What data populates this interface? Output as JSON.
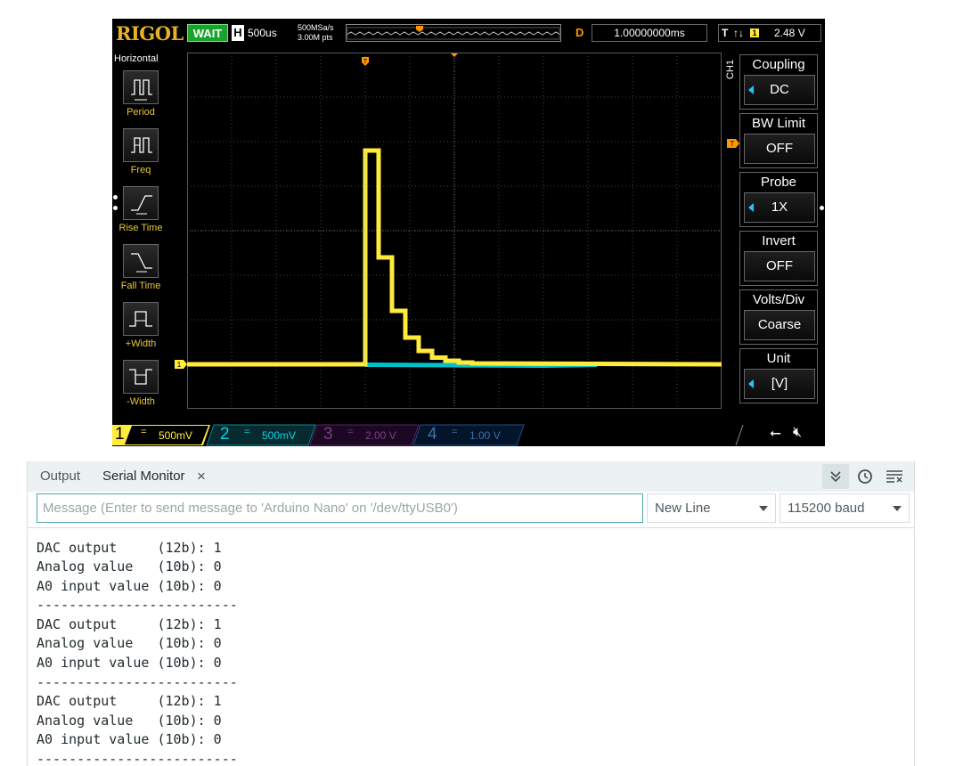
{
  "scope": {
    "brand": "RIGOL",
    "run_status": "WAIT",
    "horizontal_tag": "H",
    "timebase": "500us",
    "sample_rate": "500MSa/s",
    "memory_depth": "3.00M pts",
    "delay_tag": "D",
    "delay": "1.00000000ms",
    "trigger_tag": "T",
    "trigger_source": "1",
    "trigger_level": "2.48 V",
    "trigger_marker": "T",
    "colors": {
      "ch1": "#ffeb3b",
      "ch2": "#00d6e0",
      "ch3": "#c71ddb",
      "ch4": "#2196f3",
      "accent": "#ff9800"
    },
    "left_menu": {
      "title": "Horizontal",
      "items": [
        {
          "label": "Period",
          "icon": "period-icon"
        },
        {
          "label": "Freq",
          "icon": "freq-icon"
        },
        {
          "label": "Rise Time",
          "icon": "rise-time-icon"
        },
        {
          "label": "Fall Time",
          "icon": "fall-time-icon"
        },
        {
          "label": "+Width",
          "icon": "pos-width-icon"
        },
        {
          "label": "-Width",
          "icon": "neg-width-icon"
        }
      ]
    },
    "right_menu": {
      "channel_label": "CH1",
      "items": [
        {
          "title": "Coupling",
          "value": "DC"
        },
        {
          "title": "BW Limit",
          "value": "OFF"
        },
        {
          "title": "Probe",
          "value": "1X"
        },
        {
          "title": "Invert",
          "value": "OFF"
        },
        {
          "title": "Volts/Div",
          "value": "Coarse"
        },
        {
          "title": "Unit",
          "value": "[V]"
        }
      ]
    },
    "channels": [
      {
        "num": "1",
        "coupling": "=",
        "scale": "500mV"
      },
      {
        "num": "2",
        "coupling": "=",
        "scale": "500mV"
      },
      {
        "num": "3",
        "coupling": "=",
        "scale": "2.00 V"
      },
      {
        "num": "4",
        "coupling": "=",
        "scale": "1.00 V"
      }
    ],
    "ch1_marker": "1",
    "waveform_ch1_divs": [
      [
        0,
        0
      ],
      [
        4.0,
        0
      ],
      [
        4.0,
        4.8
      ],
      [
        4.3,
        4.8
      ],
      [
        4.3,
        2.4
      ],
      [
        4.6,
        2.4
      ],
      [
        4.6,
        1.2
      ],
      [
        4.9,
        1.2
      ],
      [
        4.9,
        0.6
      ],
      [
        5.2,
        0.6
      ],
      [
        5.2,
        0.3
      ],
      [
        5.5,
        0.3
      ],
      [
        5.5,
        0.15
      ],
      [
        5.8,
        0.15
      ],
      [
        5.8,
        0.08
      ],
      [
        6.1,
        0.08
      ],
      [
        6.1,
        0.04
      ],
      [
        6.4,
        0.04
      ],
      [
        6.4,
        0.02
      ],
      [
        12,
        0.0
      ]
    ]
  },
  "serial_monitor": {
    "tab_output": "Output",
    "tab_serial": "Serial Monitor",
    "close_glyph": "×",
    "input_placeholder": "Message (Enter to send message to 'Arduino Nano' on '/dev/ttyUSB0')",
    "input_value": "",
    "line_ending": "New Line",
    "baud_rate": "115200 baud",
    "lines": [
      "DAC output     (12b): 1",
      "Analog value   (10b): 0",
      "A0 input value (10b): 0",
      "-------------------------",
      "DAC output     (12b): 1",
      "Analog value   (10b): 0",
      "A0 input value (10b): 0",
      "-------------------------",
      "DAC output     (12b): 1",
      "Analog value   (10b): 0",
      "A0 input value (10b): 0",
      "-------------------------"
    ]
  }
}
